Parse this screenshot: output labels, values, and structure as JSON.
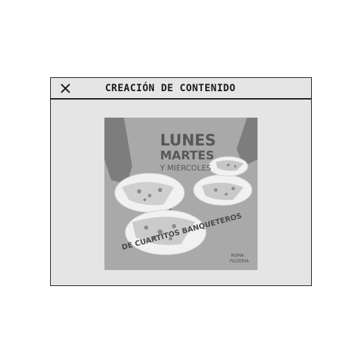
{
  "window": {
    "title": "CREACIÓN DE CONTENIDO",
    "close_icon": "close-icon"
  },
  "poster": {
    "line1": "LUNES",
    "line2": "MARTES",
    "line3": "Y MIÉRCOLES",
    "tagline": "DE CUARTITOS BANQUETEROS",
    "brand_line1": "ROMA",
    "brand_line2": "PIZZERIA"
  }
}
